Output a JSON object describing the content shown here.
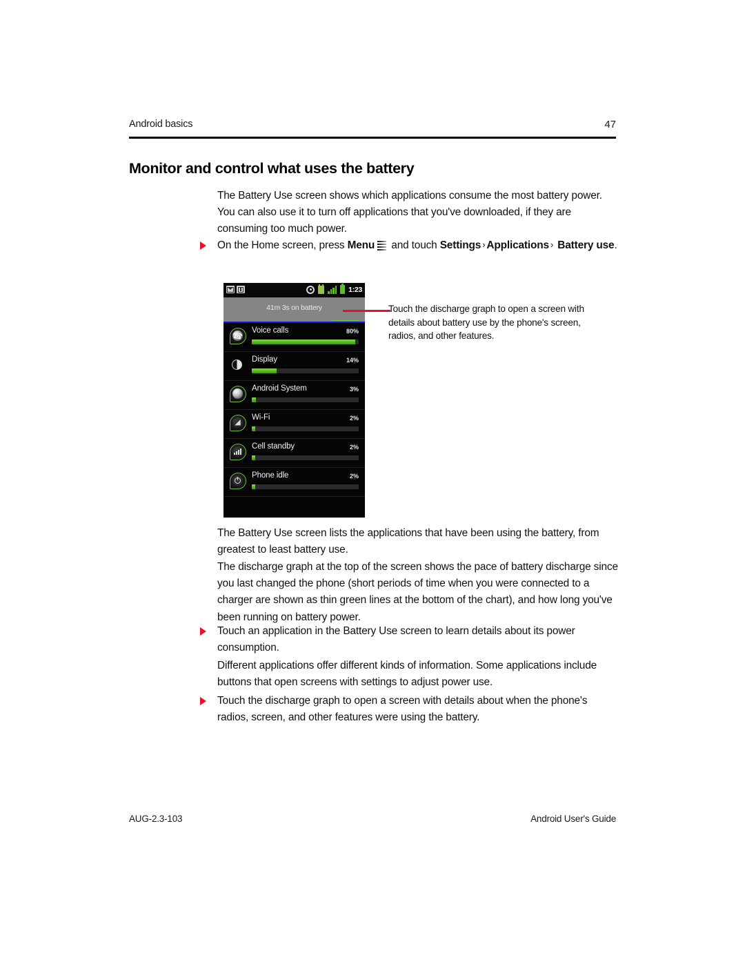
{
  "header": {
    "title": "Android basics",
    "page_number": "47"
  },
  "headline": "Monitor and control what uses the battery",
  "intro_paragraph": "The Battery Use screen shows which applications consume the most battery power. You can also use it to turn off applications that you've downloaded, if they are consuming too much power.",
  "bullets": {
    "nav": {
      "lead": "On the Home screen, press ",
      "menu_label": "Menu",
      "menu_icon": "hamburger-menu-icon",
      "mid": " and touch ",
      "settings_label": "Settings",
      "chevron": "›",
      "applications_label": "Applications",
      "battery_use_label": "Battery use",
      "period": "."
    },
    "touch_app": "Touch an application in the Battery Use screen to learn details about its power consumption.",
    "touch_graph": "Touch the discharge graph to open a screen with details about when the phone's radios, screen, and other features were using the battery."
  },
  "paragraphs": {
    "lists_apps": "The Battery Use screen lists the applications that have been using the battery, from greatest to least battery use.",
    "discharge_graph": "The discharge graph at the top of the screen shows the pace of battery discharge since you last changed the phone (short periods of time when you were connected to a charger are shown as thin green lines at the bottom of the chart), and how long you've been running on battery power.",
    "different_apps": "Different applications offer different kinds of information. Some applications include buttons that open screens with settings to adjust power use."
  },
  "callout": {
    "text": "Touch the discharge graph to open a screen with details about battery use by the phone's screen, radios, and other features."
  },
  "phone_screenshot": {
    "status_bar": {
      "clock": "1:23",
      "left_icons": [
        "mail-icon",
        "info-icon"
      ],
      "right_icons": [
        "gps-icon",
        "usb-icon",
        "signal-bars-icon",
        "battery-icon"
      ]
    },
    "discharge_graph": {
      "label": "41m 3s on battery"
    },
    "list_items": [
      {
        "name": "Voice calls",
        "percent": "80%",
        "bar_pct": 97,
        "icon": "phone-call-icon"
      },
      {
        "name": "Display",
        "percent": "14%",
        "bar_pct": 23,
        "icon": "brightness-icon"
      },
      {
        "name": "Android System",
        "percent": "3%",
        "bar_pct": 4,
        "icon": "android-system-icon"
      },
      {
        "name": "Wi-Fi",
        "percent": "2%",
        "bar_pct": 3,
        "icon": "wifi-icon"
      },
      {
        "name": "Cell standby",
        "percent": "2%",
        "bar_pct": 3,
        "icon": "cell-signal-icon"
      },
      {
        "name": "Phone idle",
        "percent": "2%",
        "bar_pct": 3,
        "icon": "power-icon"
      }
    ]
  },
  "footer": {
    "left": "AUG-2.3-103",
    "right": "Android User's Guide"
  },
  "colors": {
    "accent_red": "#e8112d",
    "battery_green": "#5fbf20",
    "graph_gray": "#858585",
    "graph_blue": "#1414d8"
  }
}
